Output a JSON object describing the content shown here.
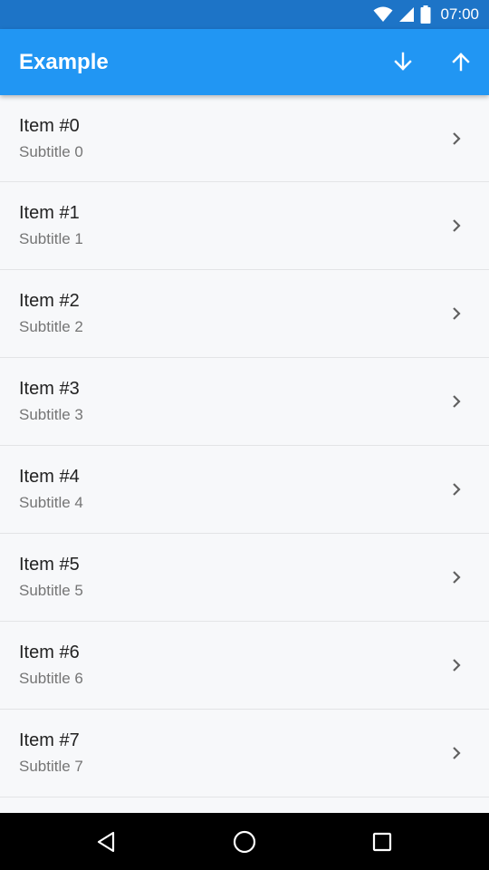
{
  "status_bar": {
    "time": "07:00",
    "icons": [
      "wifi-icon",
      "signal-icon",
      "battery-icon"
    ]
  },
  "app_bar": {
    "title": "Example",
    "actions": [
      "arrow-down-icon",
      "arrow-up-icon"
    ]
  },
  "list": {
    "items": [
      {
        "title": "Item #0",
        "subtitle": "Subtitle 0"
      },
      {
        "title": "Item #1",
        "subtitle": "Subtitle 1"
      },
      {
        "title": "Item #2",
        "subtitle": "Subtitle 2"
      },
      {
        "title": "Item #3",
        "subtitle": "Subtitle 3"
      },
      {
        "title": "Item #4",
        "subtitle": "Subtitle 4"
      },
      {
        "title": "Item #5",
        "subtitle": "Subtitle 5"
      },
      {
        "title": "Item #6",
        "subtitle": "Subtitle 6"
      },
      {
        "title": "Item #7",
        "subtitle": "Subtitle 7"
      },
      {
        "title": "",
        "subtitle": ""
      }
    ]
  },
  "nav_bar": {
    "buttons": [
      "back-triangle-icon",
      "home-circle-icon",
      "recents-square-icon"
    ]
  },
  "colors": {
    "status_bar": "#1d74c7",
    "app_bar": "#2196f3",
    "list_background": "#f7f8fa",
    "divider": "#e3e4e6",
    "title_text": "#222222",
    "subtitle_text": "#757575",
    "chevron": "#616161",
    "nav_bar": "#000000"
  }
}
